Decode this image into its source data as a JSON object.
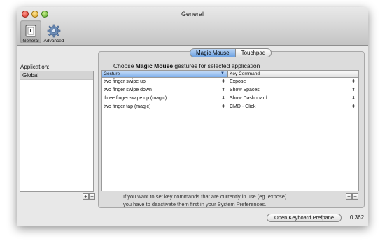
{
  "window": {
    "title": "General"
  },
  "toolbar": {
    "items": [
      {
        "label": "General",
        "icon": "general-switch-icon",
        "selected": true
      },
      {
        "label": "Advanced",
        "icon": "gear-icon",
        "selected": false
      }
    ]
  },
  "sidebar": {
    "label": "Application:",
    "items": [
      {
        "name": "Global",
        "selected": true
      }
    ],
    "add_label": "+",
    "remove_label": "−"
  },
  "tabs": [
    {
      "label": "Magic Mouse",
      "selected": true
    },
    {
      "label": "Touchpad",
      "selected": false
    }
  ],
  "instruction": {
    "prefix": "Choose ",
    "device": "Magic Mouse",
    "suffix": " gestures for selected application"
  },
  "table": {
    "headers": {
      "gesture": "Gesture",
      "command": "Key Command"
    },
    "rows": [
      {
        "gesture": "two finger swipe up",
        "command": "Expose"
      },
      {
        "gesture": "two finger swipe down",
        "command": "Show Spaces"
      },
      {
        "gesture": "three finger swipe up (magic)",
        "command": "Show Dashboard"
      },
      {
        "gesture": "two finger tap (magic)",
        "command": "CMD - Click"
      }
    ],
    "add_label": "+",
    "remove_label": "−"
  },
  "info": {
    "line1": "If you want to set key commands that are currently in use (eg. expose)",
    "line2": "you have to deactivate them first in your System Preferences."
  },
  "open_button": {
    "label": "Open Keyboard Prefpane"
  },
  "version": "0.362",
  "colors": {
    "selection": "#7fb0ec",
    "window": "#e8e8e8"
  }
}
